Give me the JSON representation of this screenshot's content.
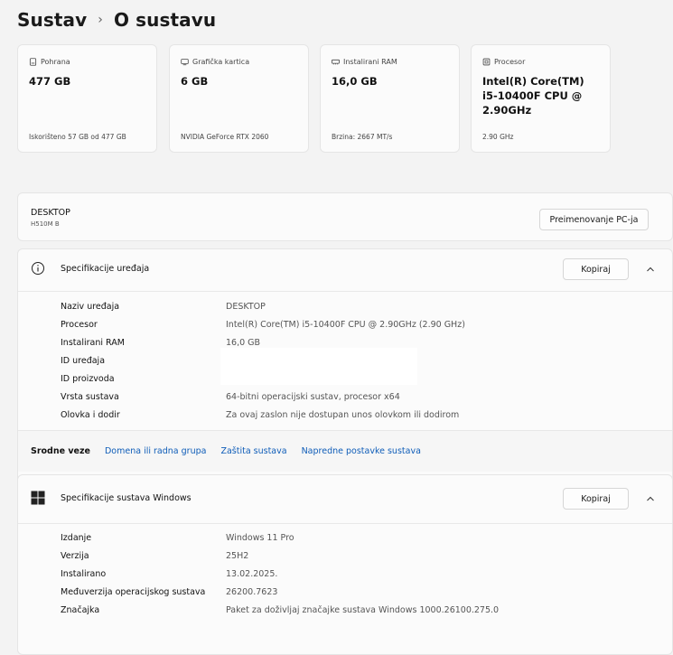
{
  "breadcrumb": {
    "parent": "Sustav",
    "separator": "›",
    "current": "O sustavu"
  },
  "cards": [
    {
      "icon": "storage-icon",
      "label": "Pohrana",
      "value": "477 GB",
      "footer": "Iskorišteno 57 GB od 477 GB"
    },
    {
      "icon": "gpu-icon",
      "label": "Grafička kartica",
      "value": "6 GB",
      "footer": "NVIDIA GeForce RTX 2060"
    },
    {
      "icon": "ram-icon",
      "label": "Instalirani RAM",
      "value": "16,0 GB",
      "footer": "Brzina: 2667 MT/s"
    },
    {
      "icon": "cpu-icon",
      "label": "Procesor",
      "value": "Intel(R) Core(TM) i5-10400F CPU @ 2.90GHz",
      "footer": "2.90 GHz"
    }
  ],
  "device": {
    "name": "DESKTOP",
    "model": "H510M B",
    "rename_label": "Preimenovanje PC-ja"
  },
  "device_specs": {
    "title": "Specifikacije uređaja",
    "copy_label": "Kopiraj",
    "rows": [
      {
        "key": "Naziv uređaja",
        "value": "DESKTOP"
      },
      {
        "key": "Procesor",
        "value": "Intel(R) Core(TM) i5-10400F CPU @ 2.90GHz (2.90 GHz)"
      },
      {
        "key": "Instalirani RAM",
        "value": "16,0 GB"
      },
      {
        "key": "ID uređaja",
        "value": ""
      },
      {
        "key": "ID proizvoda",
        "value": ""
      },
      {
        "key": "Vrsta sustava",
        "value": "64-bitni operacijski sustav, procesor x64"
      },
      {
        "key": "Olovka i dodir",
        "value": "Za ovaj zaslon nije dostupan unos olovkom ili dodirom"
      }
    ]
  },
  "related": {
    "label": "Srodne veze",
    "links": [
      "Domena ili radna grupa",
      "Zaštita sustava",
      "Napredne postavke sustava"
    ]
  },
  "windows_specs": {
    "title": "Specifikacije sustava Windows",
    "copy_label": "Kopiraj",
    "rows": [
      {
        "key": "Izdanje",
        "value": "Windows 11 Pro"
      },
      {
        "key": "Verzija",
        "value": "25H2"
      },
      {
        "key": "Instalirano",
        "value": "13.02.2025."
      },
      {
        "key": "Međuverzija operacijskog sustava",
        "value": "26200.7623"
      },
      {
        "key": "Značajka",
        "value": "Paket za doživljaj značajke sustava Windows 1000.26100.275.0"
      }
    ]
  },
  "colors": {
    "link": "#0f5db8",
    "background": "#f3f3f3",
    "card": "#fbfbfb"
  }
}
